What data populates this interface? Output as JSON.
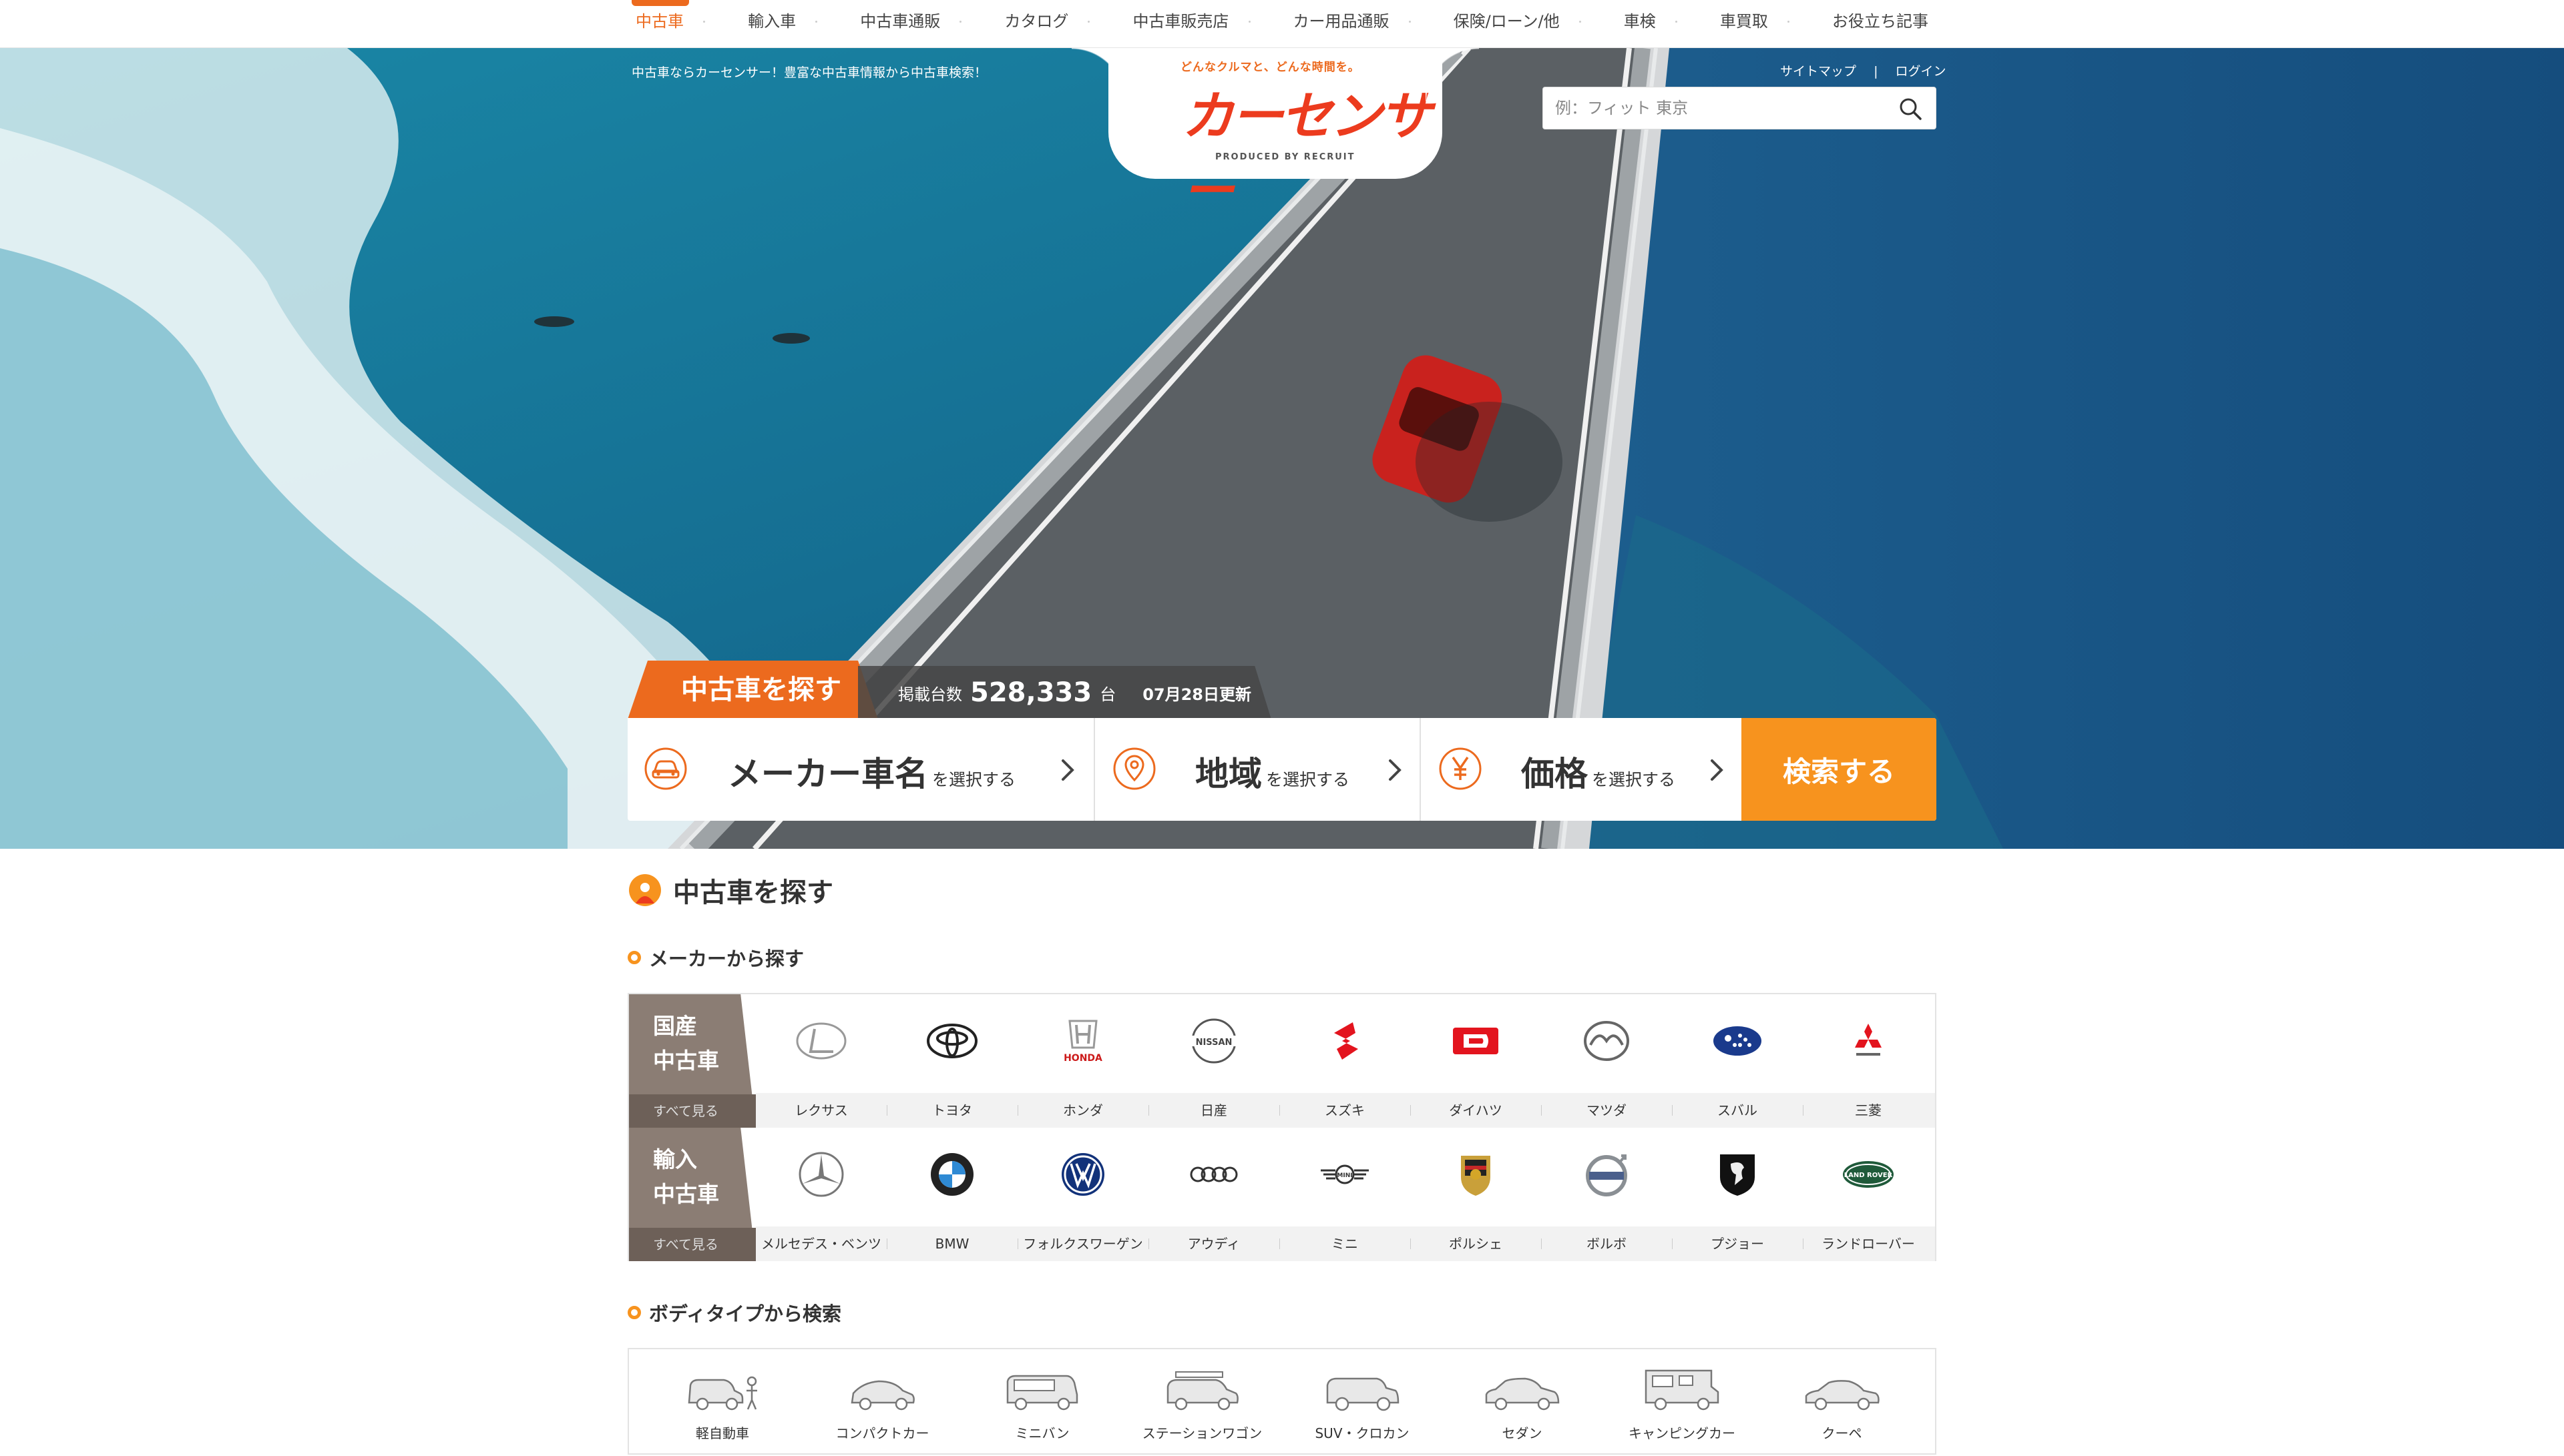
{
  "nav": {
    "items": [
      "中古車",
      "輸入車",
      "中古車通販",
      "カタログ",
      "中古車販売店",
      "カー用品通販",
      "保険/ローン/他",
      "車検",
      "車買取",
      "お役立ち記事"
    ],
    "active_index": 0
  },
  "header": {
    "tagline": "中古車ならカーセンサー！豊富な中古車情報から中古車検索！",
    "links": {
      "sitemap": "サイトマップ",
      "separator": "|",
      "login": "ログイン"
    },
    "logo": {
      "tagline": "どんなクルマと、どんな時間を。",
      "text": "カーセンサー",
      "produced_by": "PRODUCED BY RECRUIT"
    },
    "search": {
      "placeholder": "例：フィット 東京",
      "value": ""
    }
  },
  "hero_search": {
    "label": "中古車を探す",
    "count_label": "掲載台数",
    "count": "528,333",
    "count_unit": "台",
    "updated": "07月28日更新",
    "maker": {
      "main": "メーカー車名",
      "sub": "を選択する"
    },
    "area": {
      "main": "地域",
      "sub": "を選択する"
    },
    "price": {
      "main": "価格",
      "sub": "を選択する"
    },
    "search_button": "検索する"
  },
  "section": {
    "title": "中古車を探す",
    "maker_title": "メーカーから探す",
    "bodytype_title": "ボディタイプから検索"
  },
  "domestic": {
    "label_line1": "国産",
    "label_line2": "中古車",
    "see_all": "すべて見る",
    "brands": [
      "レクサス",
      "トヨタ",
      "ホンダ",
      "日産",
      "スズキ",
      "ダイハツ",
      "マツダ",
      "スバル",
      "三菱"
    ]
  },
  "imported": {
    "label_line1": "輸入",
    "label_line2": "中古車",
    "see_all": "すべて見る",
    "brands": [
      "メルセデス・ベンツ",
      "BMW",
      "フォルクスワーゲン",
      "アウディ",
      "ミニ",
      "ポルシェ",
      "ボルボ",
      "プジョー",
      "ランドローバー"
    ]
  },
  "logo_text": {
    "honda": "HONDA",
    "nissan": "NISSAN",
    "mini": "MINI",
    "landrover": "LAND ROVER"
  },
  "body_types": [
    "軽自動車",
    "コンパクトカー",
    "ミニバン",
    "ステーションワゴン",
    "SUV・クロカン",
    "セダン",
    "キャンピングカー",
    "クーペ"
  ],
  "colors": {
    "accent": "#ec6a1e",
    "search_button": "#f7931e",
    "category_bg": "#8b7d74"
  }
}
